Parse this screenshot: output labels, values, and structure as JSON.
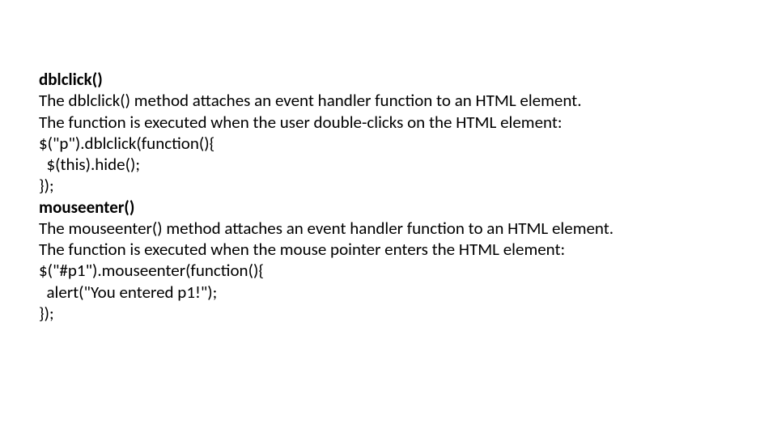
{
  "content": {
    "h1": "dblclick()",
    "p1": "The dblclick() method attaches an event handler function to an HTML element.",
    "p2": "The function is executed when the user double-clicks on the HTML element:",
    "c1": "$(\"p\").dblclick(function(){",
    "c2": "  $(this).hide();",
    "c3": "});",
    "h2": "mouseenter()",
    "p3": "The mouseenter() method attaches an event handler function to an HTML element.",
    "p4": "The function is executed when the mouse pointer enters the HTML element:",
    "c4": "$(\"#p1\").mouseenter(function(){",
    "c5": "  alert(\"You entered p1!\");",
    "c6": "});"
  }
}
